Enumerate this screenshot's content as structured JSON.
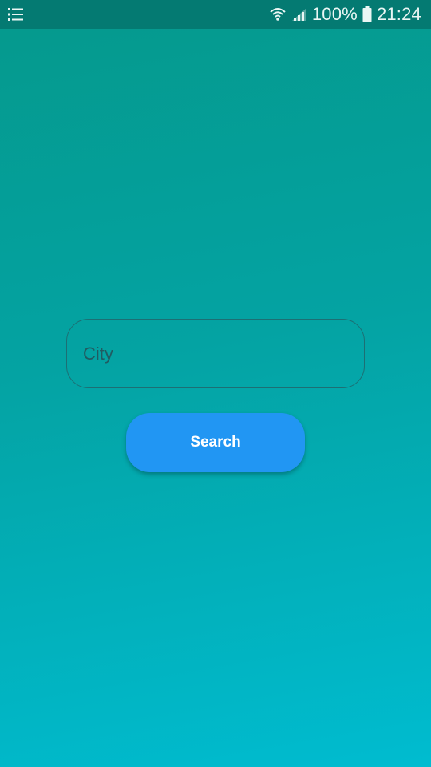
{
  "status_bar": {
    "menu_icon": "list-icon",
    "wifi_icon": "wifi-icon",
    "signal_icon": "signal-icon",
    "battery_percent": "100%",
    "battery_icon": "battery-icon",
    "time": "21:24"
  },
  "search_form": {
    "city_placeholder": "City",
    "city_value": "",
    "search_label": "Search"
  },
  "colors": {
    "status_bar_bg": "#047a72",
    "gradient_top": "#05998c",
    "gradient_bottom": "#00bcd0",
    "button_bg": "#2196f3",
    "field_border": "#1d6f74"
  }
}
